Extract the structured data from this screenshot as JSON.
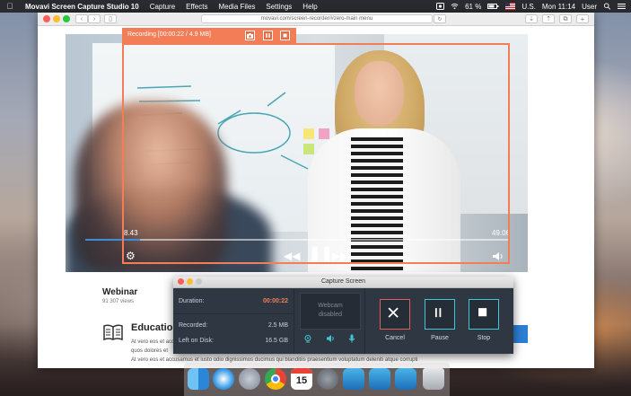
{
  "menubar": {
    "app_name": "Movavi Screen Capture Studio 10",
    "items": [
      "Capture",
      "Effects",
      "Media Files",
      "Settings",
      "Help"
    ],
    "battery": "61 %",
    "input_source": "U.S.",
    "clock": "Mon 11:14",
    "user": "User"
  },
  "browser": {
    "url": "movavi.com/screen-recorder/#zero-main menu"
  },
  "video": {
    "time_elapsed": "8.43",
    "time_total": "49.06",
    "progress_fraction": 0.13
  },
  "recording": {
    "label": "Recording [00:00:22 / 4.9 MB]"
  },
  "page": {
    "title": "Webinar",
    "views": "91 307 views",
    "section_title": "Education",
    "lorem_1": "At vero eos et accusamus et iusto odio",
    "lorem_2": "quos dolores et",
    "lorem_3": "At vero eos et accusamus et iusto odio",
    "lorem_4": "At vero eos et accusamus et iusto odio dignissimos ducimus qui blanditiis praesentium voluptatum deleniti atque corrupti"
  },
  "capture_panel": {
    "title": "Capture Screen",
    "duration_label": "Duration:",
    "duration_value": "00:00:22",
    "recorded_label": "Recorded:",
    "recorded_value": "2.5 MB",
    "disk_label": "Left on Disk:",
    "disk_value": "16.5 GB",
    "webcam_line1": "Webcam",
    "webcam_line2": "disabled",
    "cancel_label": "Cancel",
    "pause_label": "Pause",
    "stop_label": "Stop"
  },
  "colors": {
    "recording_accent": "#f27d57",
    "panel_bg": "#2e3742",
    "progress_blue": "#3b8fd9",
    "icon_teal": "#41c6d6",
    "cancel_border": "#e05b5b"
  },
  "dock": {
    "calendar_day": "15",
    "icons": [
      "finder-icon",
      "safari-icon",
      "launchpad-icon",
      "chrome-icon",
      "calendar-icon",
      "system-preferences-icon",
      "movavi-icon",
      "movavi-editor-icon",
      "movavi-player-icon",
      "trash-icon"
    ]
  }
}
